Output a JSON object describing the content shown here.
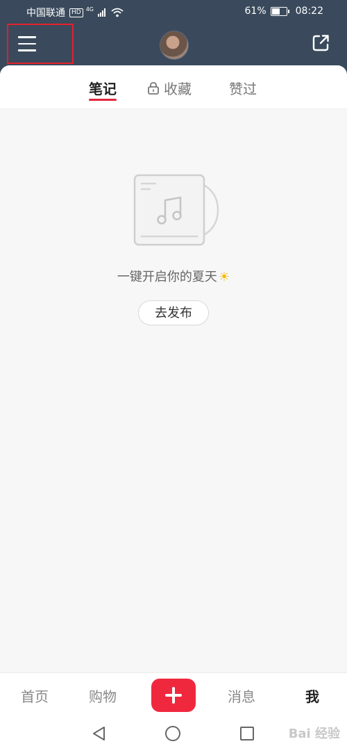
{
  "status_bar": {
    "carrier": "中国联通",
    "hd_badge": "HD",
    "network": "4G",
    "battery_text": "61%",
    "battery_level": 0.61,
    "time": "08:22"
  },
  "header": {
    "menu_icon": "hamburger-menu-icon",
    "avatar": "user-avatar",
    "share_icon": "share-external-icon"
  },
  "tabs": [
    {
      "label": "笔记",
      "active": true
    },
    {
      "label": "收藏",
      "locked": true
    },
    {
      "label": "赞过"
    }
  ],
  "empty_state": {
    "illustration": "music-note-document-icon",
    "message": "一键开启你的夏天",
    "emoji": "☀",
    "button_label": "去发布"
  },
  "bottom_tabs": {
    "home": "首页",
    "shop": "购物",
    "add_icon": "plus-icon",
    "messages": "消息",
    "me": "我"
  },
  "watermark": "Bai 经验"
}
